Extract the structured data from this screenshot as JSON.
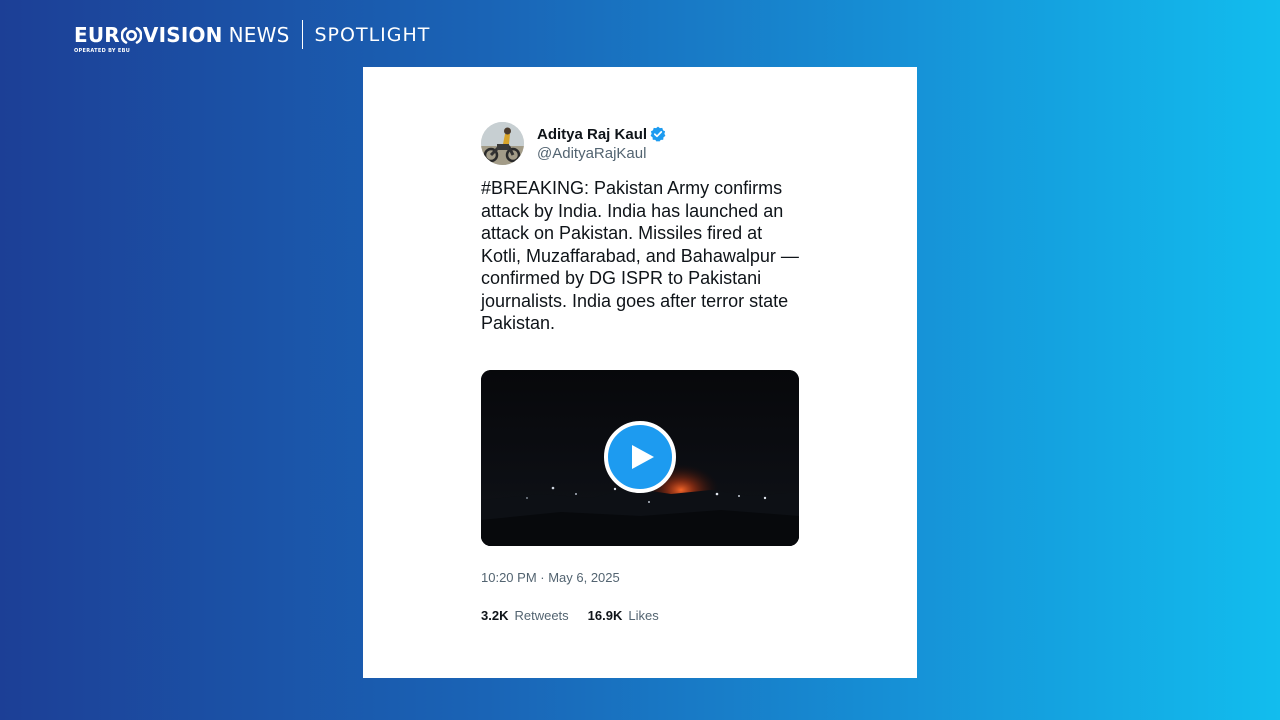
{
  "brand": {
    "euro": "EUR",
    "vision": "VISION",
    "news": "NEWS",
    "operated": "OPERATED BY EBU",
    "section": "SPOTLIGHT"
  },
  "tweet": {
    "author_name": "Aditya Raj Kaul",
    "handle": "@AdityaRajKaul",
    "verified": true,
    "text": "#BREAKING: Pakistan Army confirms attack by India. India has launched an attack on Pakistan. Missiles fired at Kotli, Muzaffarabad, and Bahawalpur — confirmed by DG ISPR to Pakistani journalists. India goes after terror state Pakistan.",
    "timestamp": "10:20 PM · May 6, 2025",
    "stats": {
      "retweets_count": "3.2K",
      "retweets_label": "Retweets",
      "likes_count": "16.9K",
      "likes_label": "Likes"
    },
    "media": {
      "type": "video",
      "play_icon": "play-icon"
    }
  },
  "colors": {
    "accent": "#1d9bf0",
    "background_start": "#1c3f96",
    "background_end": "#12bdee",
    "handle_gray": "#536471"
  }
}
